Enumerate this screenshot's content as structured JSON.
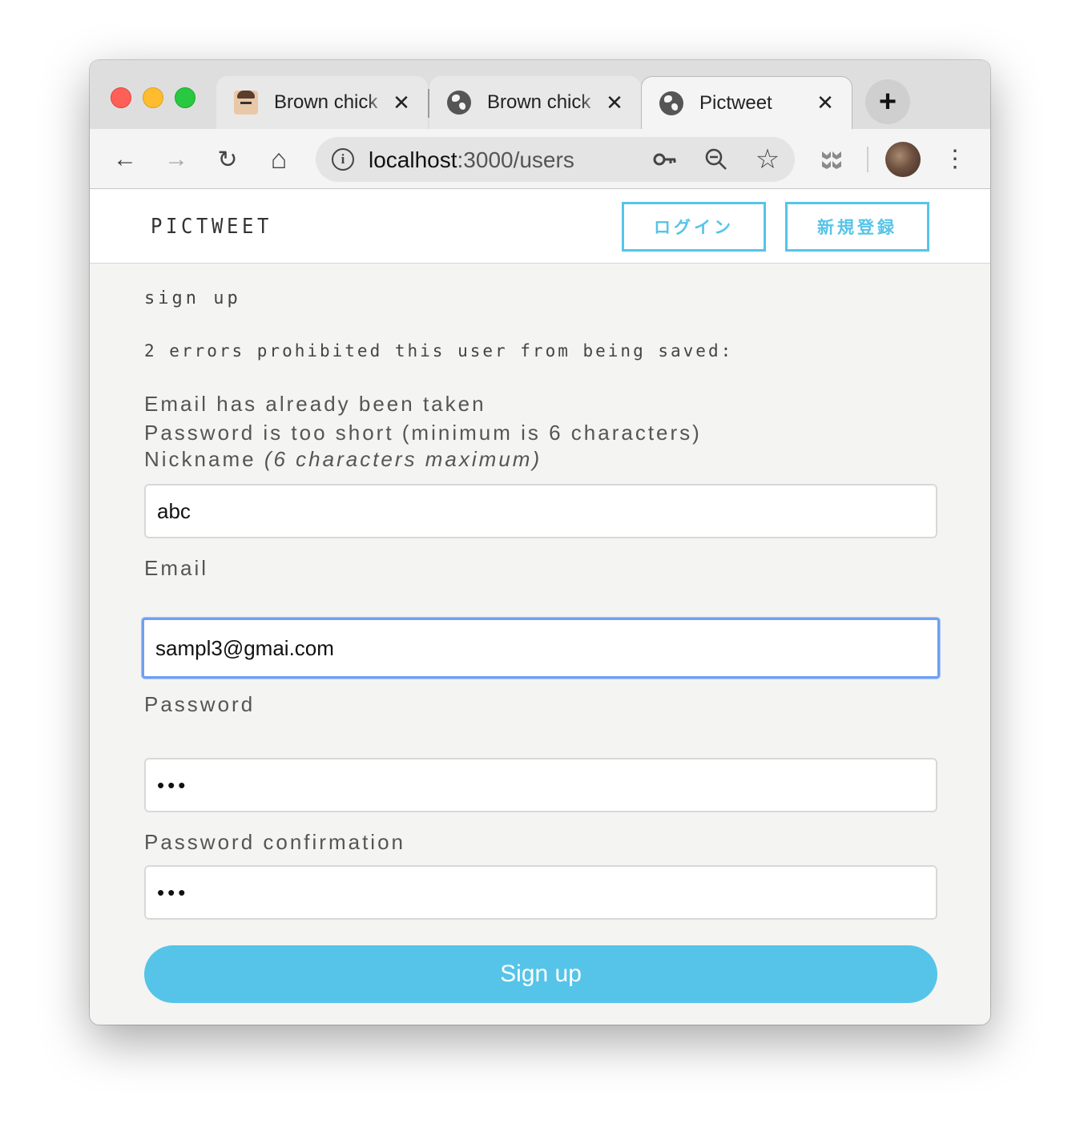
{
  "browser": {
    "tabs": [
      {
        "title": "Brown chick",
        "icon": "face-favicon",
        "close": "✕"
      },
      {
        "title": "Brown chick",
        "icon": "globe-favicon",
        "close": "✕"
      },
      {
        "title": "Pictweet",
        "icon": "globe-favicon",
        "close": "✕"
      }
    ],
    "new_tab": "+",
    "url_host": "localhost",
    "url_rest": ":3000/users",
    "nav_icons": {
      "back": "←",
      "forward": "→",
      "reload": "↻",
      "home": "⌂"
    },
    "omni_icons": {
      "key": "key-icon",
      "zoom": "zoom-out-icon",
      "star": "☆"
    },
    "menu": "⋮"
  },
  "site": {
    "logo": "Pictweet",
    "login_label": "ログイン",
    "signup_label": "新規登録"
  },
  "form": {
    "title": "sign up",
    "error_heading": "2 errors prohibited this user from being saved:",
    "errors": [
      "Email has already been taken",
      "Password is too short (minimum is 6 characters)"
    ],
    "nickname_label": "Nickname",
    "nickname_hint": "(6 characters maximum)",
    "nickname_value": "abc",
    "email_label": "Email",
    "email_value": "sampl3@gmai.com",
    "password_label": "Password",
    "password_value": "•••",
    "password_confirmation_label": "Password confirmation",
    "password_confirmation_value": "•••",
    "submit_label": "Sign up"
  },
  "colors": {
    "accent": "#56c4e8",
    "focus_ring": "#6ea0f4",
    "page_bg": "#f4f4f2"
  }
}
